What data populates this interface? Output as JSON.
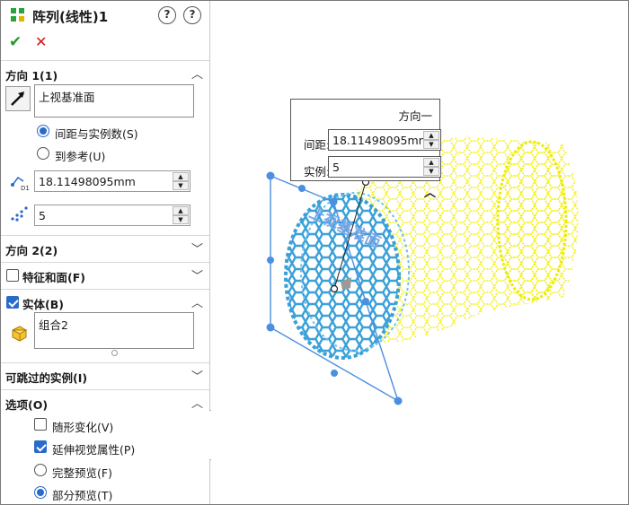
{
  "header": {
    "title": "阵列(线性)1",
    "help_icon": "?"
  },
  "actions": {
    "ok_icon": "✔",
    "cancel_icon": "✕"
  },
  "direction1": {
    "label": "方向 1(1)",
    "reference": "上视基准面",
    "spacing_option": "间距与实例数(S)",
    "to_reference_option": "到参考(U)",
    "selected_option": "spacing",
    "spacing_value": "18.11498095mm",
    "instances_value": "5"
  },
  "direction2": {
    "label": "方向 2(2)"
  },
  "features_faces": {
    "label": "特征和面(F)",
    "checked": false
  },
  "bodies": {
    "label": "实体(B)",
    "checked": true,
    "item": "组合2"
  },
  "instances_to_skip": {
    "label": "可跳过的实例(I)"
  },
  "options": {
    "label": "选项(O)",
    "vary_sketch": {
      "label": "随形变化(V)",
      "checked": false
    },
    "propagate_visual": {
      "label": "延伸视觉属性(P)",
      "checked": true
    },
    "full_preview": {
      "label": "完整预览(F)",
      "selected": false
    },
    "partial_preview": {
      "label": "部分预览(T)",
      "selected": true
    }
  },
  "callout": {
    "title": "方向一",
    "spacing_label": "间距:",
    "spacing_value": "18.11498095mm",
    "instances_label": "实例:",
    "instances_value": "5"
  },
  "viewport": {
    "plane_label": "上视基准面"
  },
  "colors": {
    "accent": "#2a6ac9",
    "ok": "#1f9a2b",
    "cancel": "#d3161a",
    "pattern_preview": "#ffff00",
    "seed_body": "#3aa0d8"
  }
}
